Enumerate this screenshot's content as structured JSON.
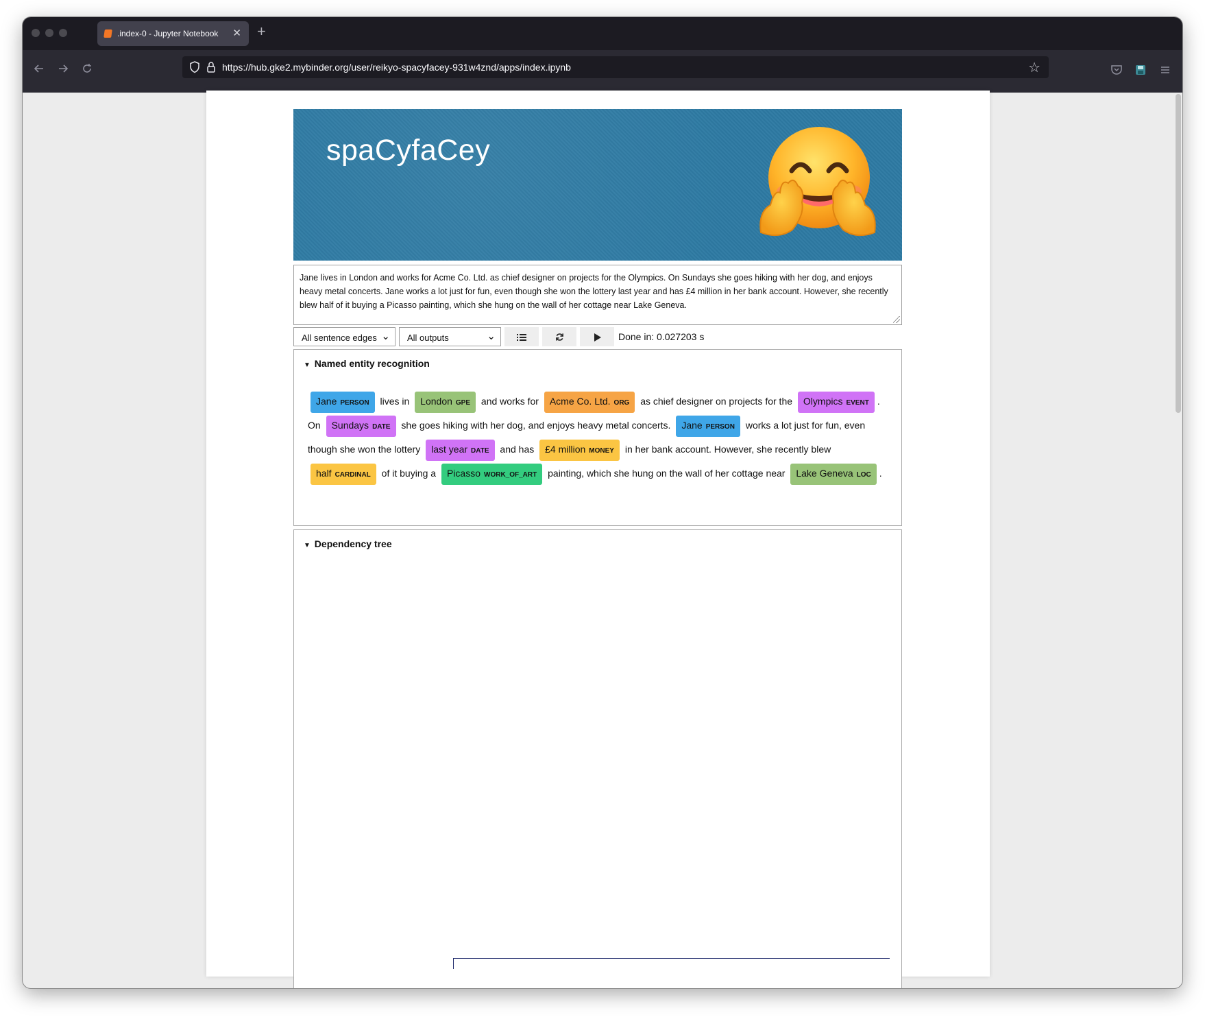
{
  "browser": {
    "tab_title": ".index-0 - Jupyter Notebook",
    "tab_close": "✕",
    "new_tab": "+",
    "url": "https://hub.gke2.mybinder.org/user/reikyo-spacyfacey-931w4znd/apps/index.ipynb"
  },
  "app": {
    "title": "spaCyfaCey",
    "input_text": "Jane lives in London and works for Acme Co. Ltd. as chief designer on projects for the Olympics. On Sundays she goes hiking with her dog, and enjoys heavy metal concerts. Jane works a lot just for fun, even though she won the lottery last year and has £4 million in her bank account. However, she recently blew half of it buying a Picasso painting, which she hung on the wall of her cottage near Lake Geneva.",
    "select_edges": "All sentence edges",
    "select_outputs": "All outputs",
    "status": "Done in: 0.027203 s"
  },
  "ner": {
    "header": "Named entity recognition",
    "segments": [
      {
        "ent": true,
        "text": "Jane",
        "label": "PERSON",
        "color": "#3fa6e8"
      },
      {
        "ent": false,
        "text": " lives in "
      },
      {
        "ent": true,
        "text": "London",
        "label": "GPE",
        "color": "#98c378"
      },
      {
        "ent": false,
        "text": " and works for "
      },
      {
        "ent": true,
        "text": "Acme Co. Ltd.",
        "label": "ORG",
        "color": "#f6a445"
      },
      {
        "ent": false,
        "text": " as chief designer on projects for the "
      },
      {
        "ent": true,
        "text": "Olympics",
        "label": "EVENT",
        "color": "#d073f6"
      },
      {
        "ent": false,
        "text": ". On "
      },
      {
        "ent": true,
        "text": "Sundays",
        "label": "DATE",
        "color": "#d073f6"
      },
      {
        "ent": false,
        "text": " she goes hiking with her dog, and enjoys heavy metal concerts. "
      },
      {
        "ent": true,
        "text": "Jane",
        "label": "PERSON",
        "color": "#3fa6e8"
      },
      {
        "ent": false,
        "text": " works a lot just for fun, even though she won the lottery "
      },
      {
        "ent": true,
        "text": "last year",
        "label": "DATE",
        "color": "#d073f6"
      },
      {
        "ent": false,
        "text": " and has "
      },
      {
        "ent": true,
        "text": "£4 million",
        "label": "MONEY",
        "color": "#fbc543"
      },
      {
        "ent": false,
        "text": " in her bank account. However, she recently blew "
      },
      {
        "ent": true,
        "text": "half",
        "label": "CARDINAL",
        "color": "#fbc543"
      },
      {
        "ent": false,
        "text": " of it buying a "
      },
      {
        "ent": true,
        "text": "Picasso",
        "label": "WORK_OF_ART",
        "color": "#33cc7f"
      },
      {
        "ent": false,
        "text": " painting, which she hung on the wall of her cottage near "
      },
      {
        "ent": true,
        "text": "Lake Geneva",
        "label": "LOC",
        "color": "#98c378"
      },
      {
        "ent": false,
        "text": "."
      }
    ]
  },
  "dependency": {
    "header": "Dependency tree"
  },
  "icons": {
    "list": "list-icon",
    "refresh": "refresh-icon",
    "play": "play-icon",
    "emoji": "hugging-face-emoji"
  }
}
